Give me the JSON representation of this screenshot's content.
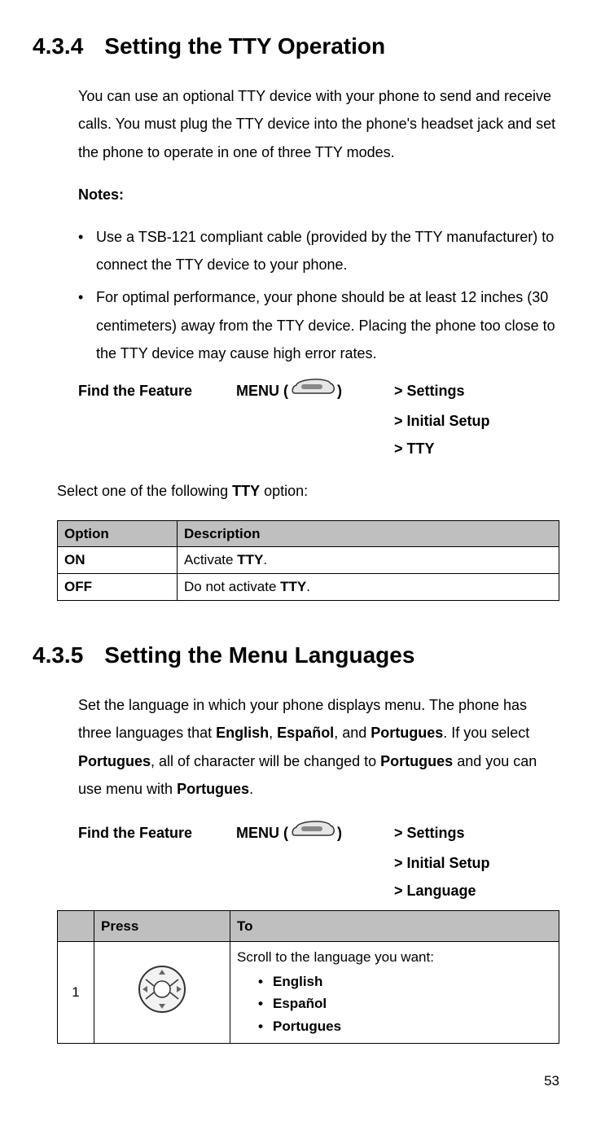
{
  "sec434": {
    "number": "4.3.4",
    "title": "Setting the TTY Operation",
    "intro": "You can use an optional TTY device with your phone to send and receive calls. You must plug the TTY device into the phone's headset jack and set the phone to operate in one of three TTY modes.",
    "notes_label": "Notes:",
    "bullets": [
      "Use a TSB-121 compliant cable (provided by the TTY manufacturer) to connect the TTY device to your phone.",
      "For optimal performance, your phone should be at least 12 inches (30 centimeters) away from the TTY device. Placing the phone too close to the TTY device may cause high error rates."
    ],
    "find_label": "Find the Feature",
    "menu_prefix": "MENU (",
    "menu_suffix": ")",
    "crumbs": [
      "> Settings",
      "> Initial Setup",
      "> TTY"
    ],
    "select_intro_a": "Select one of the following ",
    "select_intro_b": "TTY",
    "select_intro_c": " option:",
    "table": {
      "h1": "Option",
      "h2": "Description",
      "r1c1": "ON",
      "r1c2a": "Activate ",
      "r1c2b": "TTY",
      "r1c2c": ".",
      "r2c1": "OFF",
      "r2c2a": "Do not activate ",
      "r2c2b": "TTY",
      "r2c2c": "."
    }
  },
  "sec435": {
    "number": "4.3.5",
    "title": "Setting the Menu Languages",
    "intro_parts": {
      "a": "Set the language in which your phone displays menu. The phone has three languages that ",
      "b": "English",
      "c": ", ",
      "d": "Español",
      "e": ", and ",
      "f": "Portugues",
      "g": ". If you select ",
      "h": "Portugues",
      "i": ", all of character will be changed to ",
      "j": "Portugues",
      "k": " and you can use menu with ",
      "l": "Portugues",
      "m": "."
    },
    "find_label": "Find the Feature",
    "menu_prefix": "MENU (",
    "menu_suffix": ")",
    "crumbs": [
      "> Settings",
      "> Initial Setup",
      "> Language"
    ],
    "table": {
      "h_blank": "",
      "h_press": "Press",
      "h_to": "To",
      "step_num": "1",
      "to_intro": "Scroll to the language you want:",
      "langs": [
        "English",
        "Español",
        "Portugues"
      ]
    }
  },
  "page_number": "53"
}
